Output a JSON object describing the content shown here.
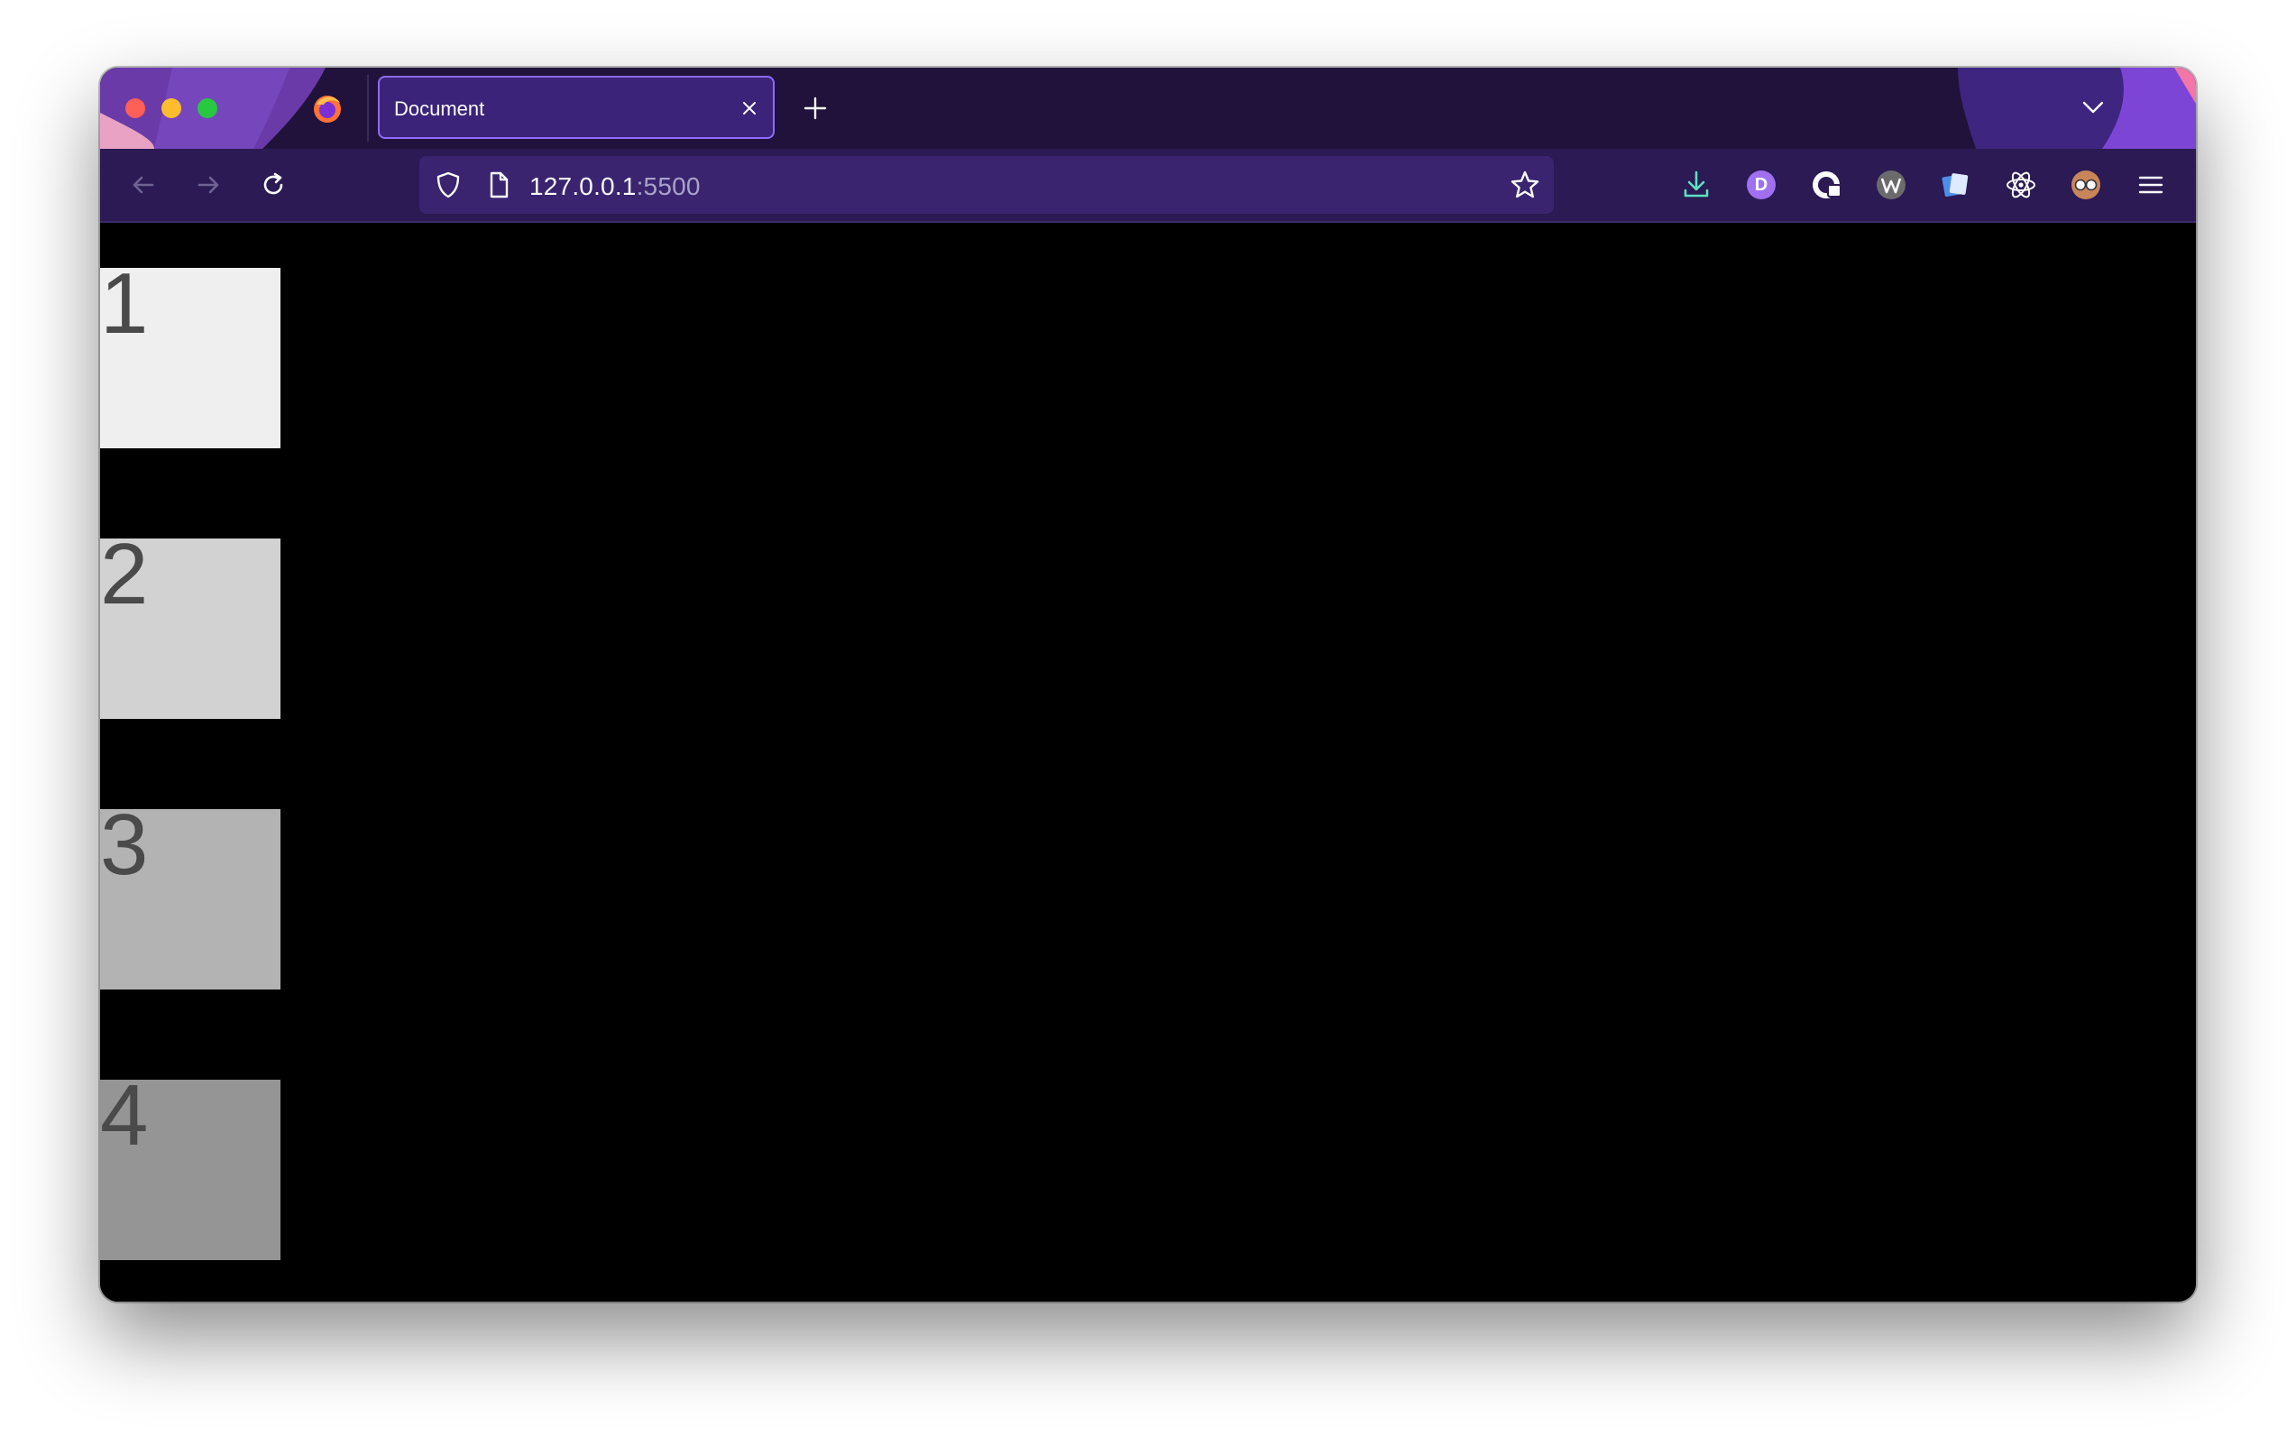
{
  "browser": {
    "tab": {
      "title": "Document"
    },
    "url": {
      "host": "127.0.0.1",
      "port": ":5500"
    },
    "toolbar_icons": [
      "back-arrow-icon",
      "forward-arrow-icon",
      "reload-icon",
      "shield-icon",
      "page-icon",
      "star-icon",
      "download-icon",
      "extension-d-icon",
      "extension-lock-icon",
      "extension-w-icon",
      "extension-cards-icon",
      "react-devtools-icon",
      "extension-glasses-icon",
      "hamburger-menu-icon"
    ],
    "extension_d_letter": "D",
    "colors": {
      "tabstrip": "#20123a",
      "navbar": "#2b1a53",
      "tab_active": "#3b2379",
      "accent": "#8f6bff"
    }
  },
  "page": {
    "background": "#000000",
    "boxes": [
      {
        "label": "1",
        "color": "#efefef"
      },
      {
        "label": "2",
        "color": "#d2d2d2"
      },
      {
        "label": "3",
        "color": "#b3b3b3"
      },
      {
        "label": "4",
        "color": "#959595"
      }
    ]
  }
}
